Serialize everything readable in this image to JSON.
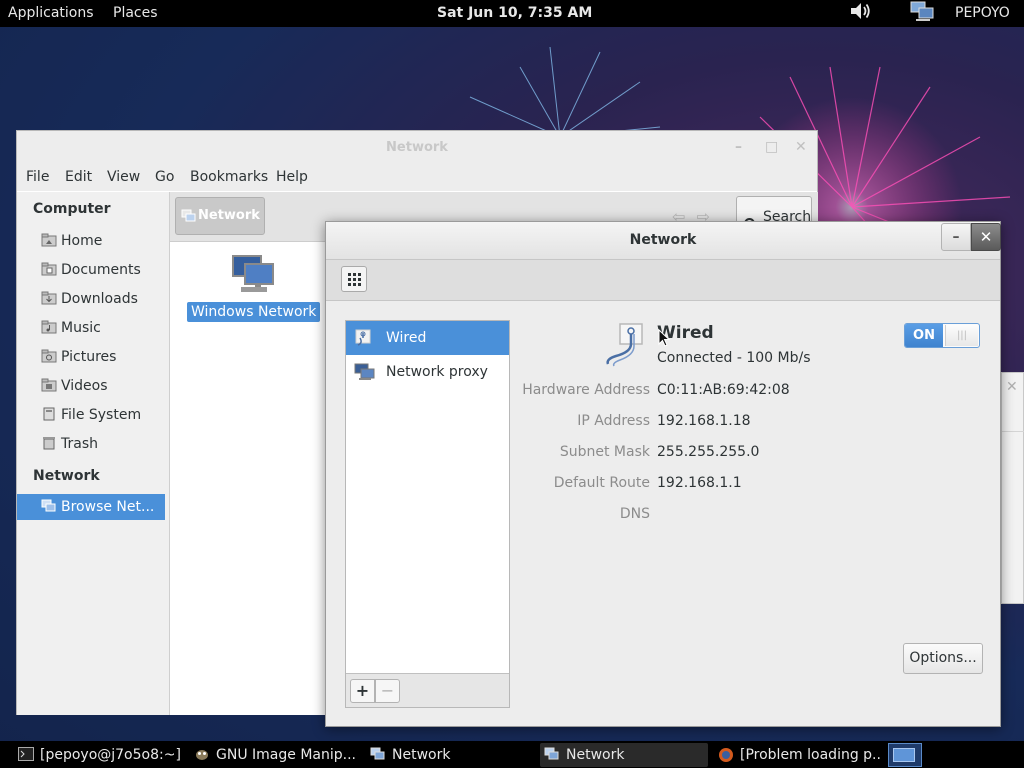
{
  "top_bar": {
    "applications": "Applications",
    "places": "Places",
    "clock": "Sat Jun 10,  7:35 AM",
    "user": "PEPOYO",
    "volume_icon": "volume-icon",
    "network_icon": "network-indicator-icon"
  },
  "nautilus": {
    "title": "Network",
    "menu": [
      "File",
      "Edit",
      "View",
      "Go",
      "Bookmarks",
      "Help"
    ],
    "sidebar": {
      "heading_computer": "Computer",
      "computer_items": [
        "Home",
        "Documents",
        "Downloads",
        "Music",
        "Pictures",
        "Videos",
        "File System",
        "Trash"
      ],
      "heading_network": "Network",
      "network_items": [
        "Browse Net..."
      ]
    },
    "path_button": "Network",
    "search_label": "Search",
    "content_items": [
      "Windows Network"
    ]
  },
  "network_settings": {
    "title": "Network",
    "devices": [
      "Wired",
      "Network proxy"
    ],
    "add_label": "+",
    "remove_label": "−",
    "wired": {
      "title": "Wired",
      "status": "Connected - 100 Mb/s",
      "toggle_label": "ON",
      "toggle_state": "on"
    },
    "details": [
      {
        "label": "Hardware Address",
        "value": "C0:11:AB:69:42:08"
      },
      {
        "label": "IP Address",
        "value": "192.168.1.18"
      },
      {
        "label": "Subnet Mask",
        "value": "255.255.255.0"
      },
      {
        "label": "Default Route",
        "value": "192.168.1.1"
      },
      {
        "label": "DNS",
        "value": ""
      }
    ],
    "options_label": "Options..."
  },
  "taskbar": [
    {
      "label": "[pepoyo@j7o5o8:~]",
      "icon": "terminal-icon"
    },
    {
      "label": "GNU Image Manip...",
      "icon": "gimp-icon"
    },
    {
      "label": "Network",
      "icon": "network-icon"
    },
    {
      "label": "Network",
      "icon": "network-icon"
    },
    {
      "label": "[Problem loading p...",
      "icon": "firefox-icon"
    }
  ],
  "colors": {
    "accent": "#4a90d9",
    "panel": "#000000",
    "window_bg": "#ededed"
  }
}
